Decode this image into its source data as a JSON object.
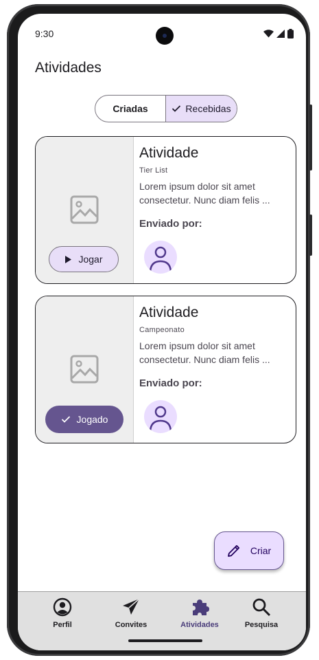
{
  "status_bar": {
    "time": "9:30"
  },
  "header": {
    "title": "Atividades"
  },
  "segmented": {
    "option1": "Criadas",
    "option2": "Recebidas",
    "selected": "Recebidas"
  },
  "cards": [
    {
      "title": "Atividade",
      "subtitle": "Tier List",
      "text_line1": "Lorem ipsum dolor sit amet",
      "text_line2": "consectetur. Nunc diam felis ...",
      "sent_by": "Enviado por:",
      "button": "Jogar"
    },
    {
      "title": "Atividade",
      "subtitle": "Campeonato",
      "text_line1": "Lorem ipsum dolor sit amet",
      "text_line2": "consectetur. Nunc diam felis ...",
      "sent_by": "Enviado por:",
      "button": "Jogado"
    }
  ],
  "fab": {
    "label": "Criar"
  },
  "nav": [
    {
      "label": "Perfil",
      "icon": "account-circle-icon"
    },
    {
      "label": "Convites",
      "icon": "send-icon"
    },
    {
      "label": "Atividades",
      "icon": "puzzle-icon",
      "active": true
    },
    {
      "label": "Pesquisa",
      "icon": "search-icon"
    }
  ],
  "colors": {
    "accent": "#65558f",
    "secondary_container": "#e8def8",
    "avatar_bg": "#eaddff",
    "nav_bg": "#e0e0e0"
  }
}
